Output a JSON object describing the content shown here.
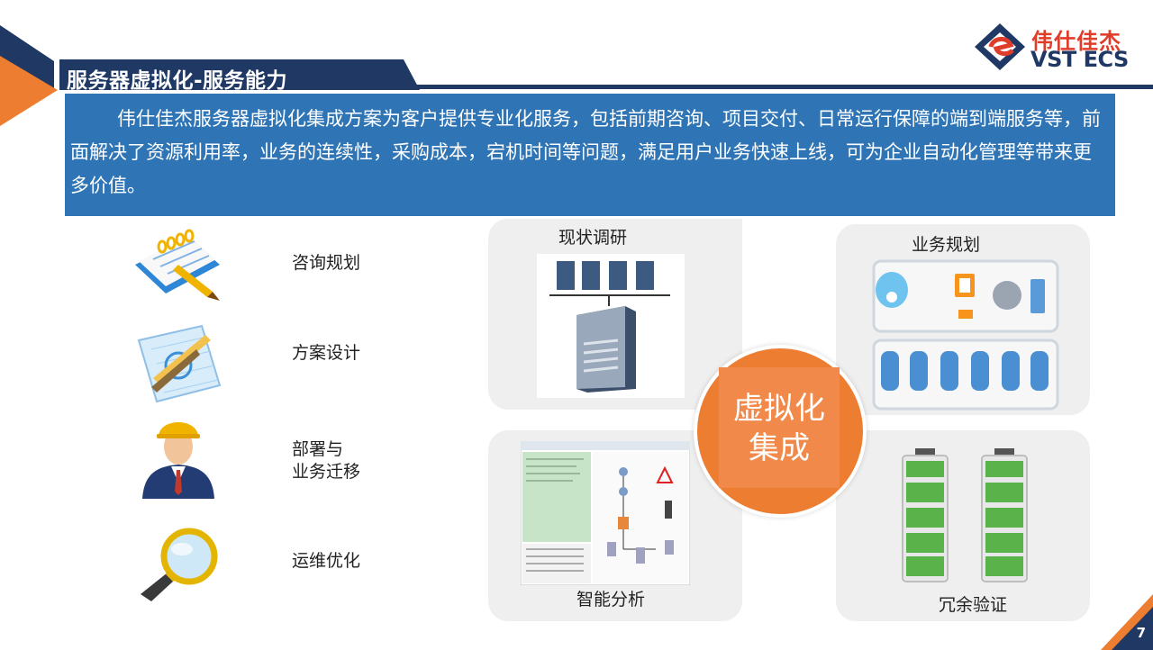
{
  "slide": {
    "title": "服务器虚拟化-服务能力",
    "intro": "伟仕佳杰服务器虚拟化集成方案为客户提供专业化服务，包括前期咨询、项目交付、日常运行保障的端到端服务等，前面解决了资源利用率，业务的连续性，采购成本，宕机时间等问题，满足用户业务快速上线，可为企业自动化管理等带来更多价值。",
    "page_number": "7"
  },
  "logo": {
    "cn": "伟仕佳杰",
    "en": "VST ECS"
  },
  "left_items": [
    {
      "label": "咨询规划",
      "icon": "notebook-pen-icon"
    },
    {
      "label": "方案设计",
      "icon": "blueprint-ruler-icon"
    },
    {
      "label": "部署与\n业务迁移",
      "icon": "engineer-icon"
    },
    {
      "label": "运维优化",
      "icon": "magnifier-icon"
    }
  ],
  "panels": {
    "top_left": "现状调研",
    "top_right": "业务规划",
    "bottom_left": "智能分析",
    "bottom_right": "冗余验证"
  },
  "center": {
    "line1": "虚拟化",
    "line2": "集成"
  },
  "colors": {
    "navy": "#1f3864",
    "blue": "#2f75b5",
    "orange": "#ed7d31",
    "red": "#e03c2a"
  }
}
